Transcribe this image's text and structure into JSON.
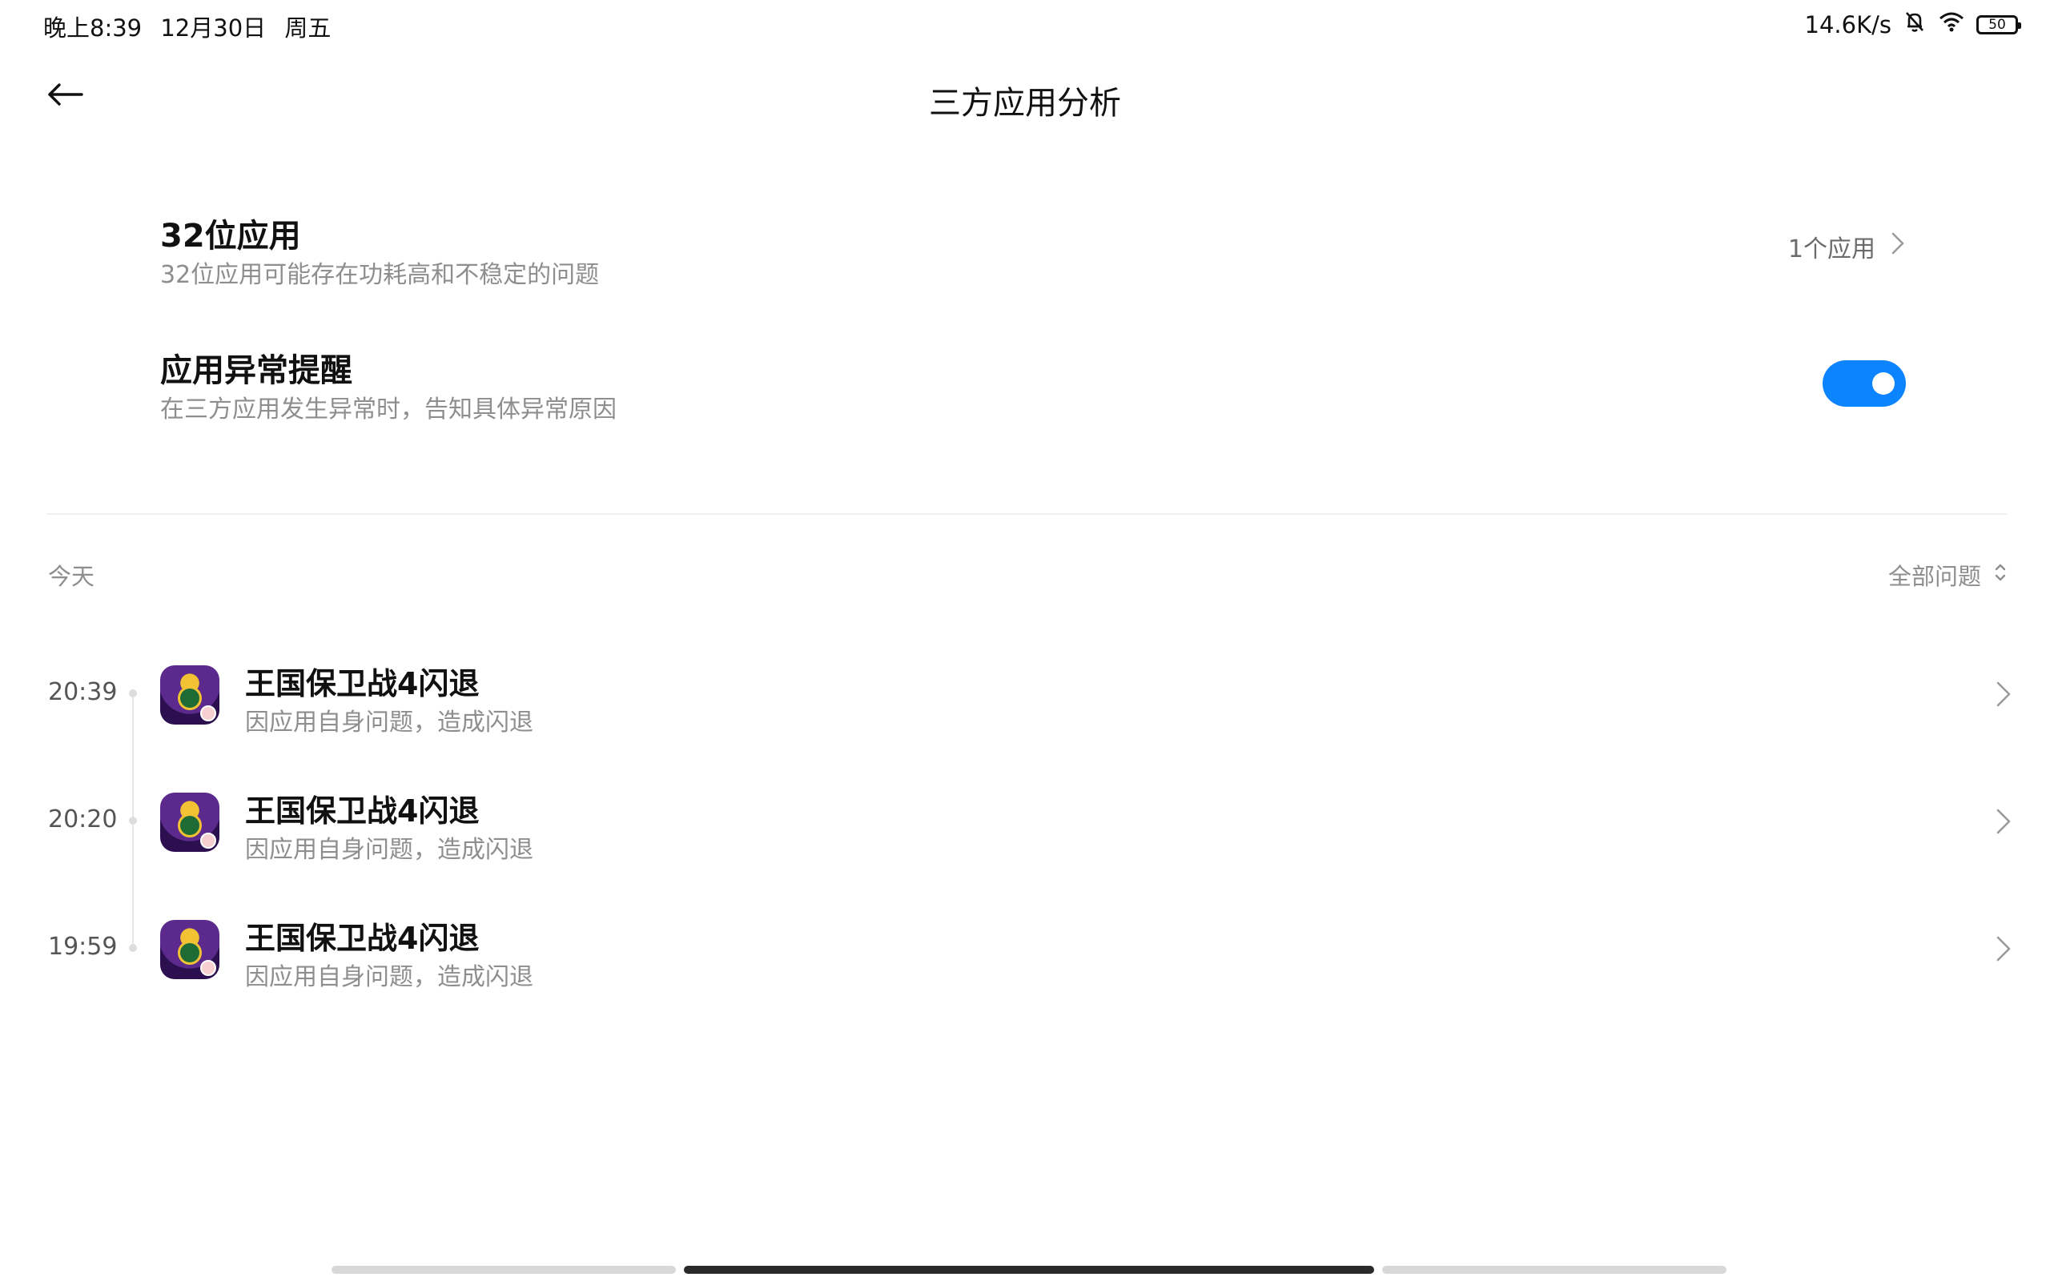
{
  "status_bar": {
    "time": "晚上8:39",
    "date": "12月30日",
    "weekday": "周五",
    "network_speed": "14.6K/s",
    "battery": "50",
    "icons": [
      "bell-muted-icon",
      "wifi-icon",
      "battery-icon"
    ]
  },
  "header": {
    "title": "三方应用分析",
    "back_icon": "back-arrow-icon"
  },
  "settings": {
    "app32": {
      "title": "32位应用",
      "description": "32位应用可能存在功耗高和不稳定的问题",
      "value": "1个应用"
    },
    "anomaly_alert": {
      "title": "应用异常提醒",
      "description": "在三方应用发生异常时，告知具体异常原因",
      "enabled": true
    }
  },
  "section": {
    "label": "今天",
    "filter": "全部问题"
  },
  "events": [
    {
      "time": "20:39",
      "title": "王国保卫战4闪退",
      "description": "因应用自身问题，造成闪退"
    },
    {
      "time": "20:20",
      "title": "王国保卫战4闪退",
      "description": "因应用自身问题，造成闪退"
    },
    {
      "time": "19:59",
      "title": "王国保卫战4闪退",
      "description": "因应用自身问题，造成闪退"
    }
  ],
  "colors": {
    "accent": "#0d84ff",
    "primary_text": "#111111",
    "secondary_text": "#8e8e8e",
    "divider": "#f0f0f0"
  }
}
